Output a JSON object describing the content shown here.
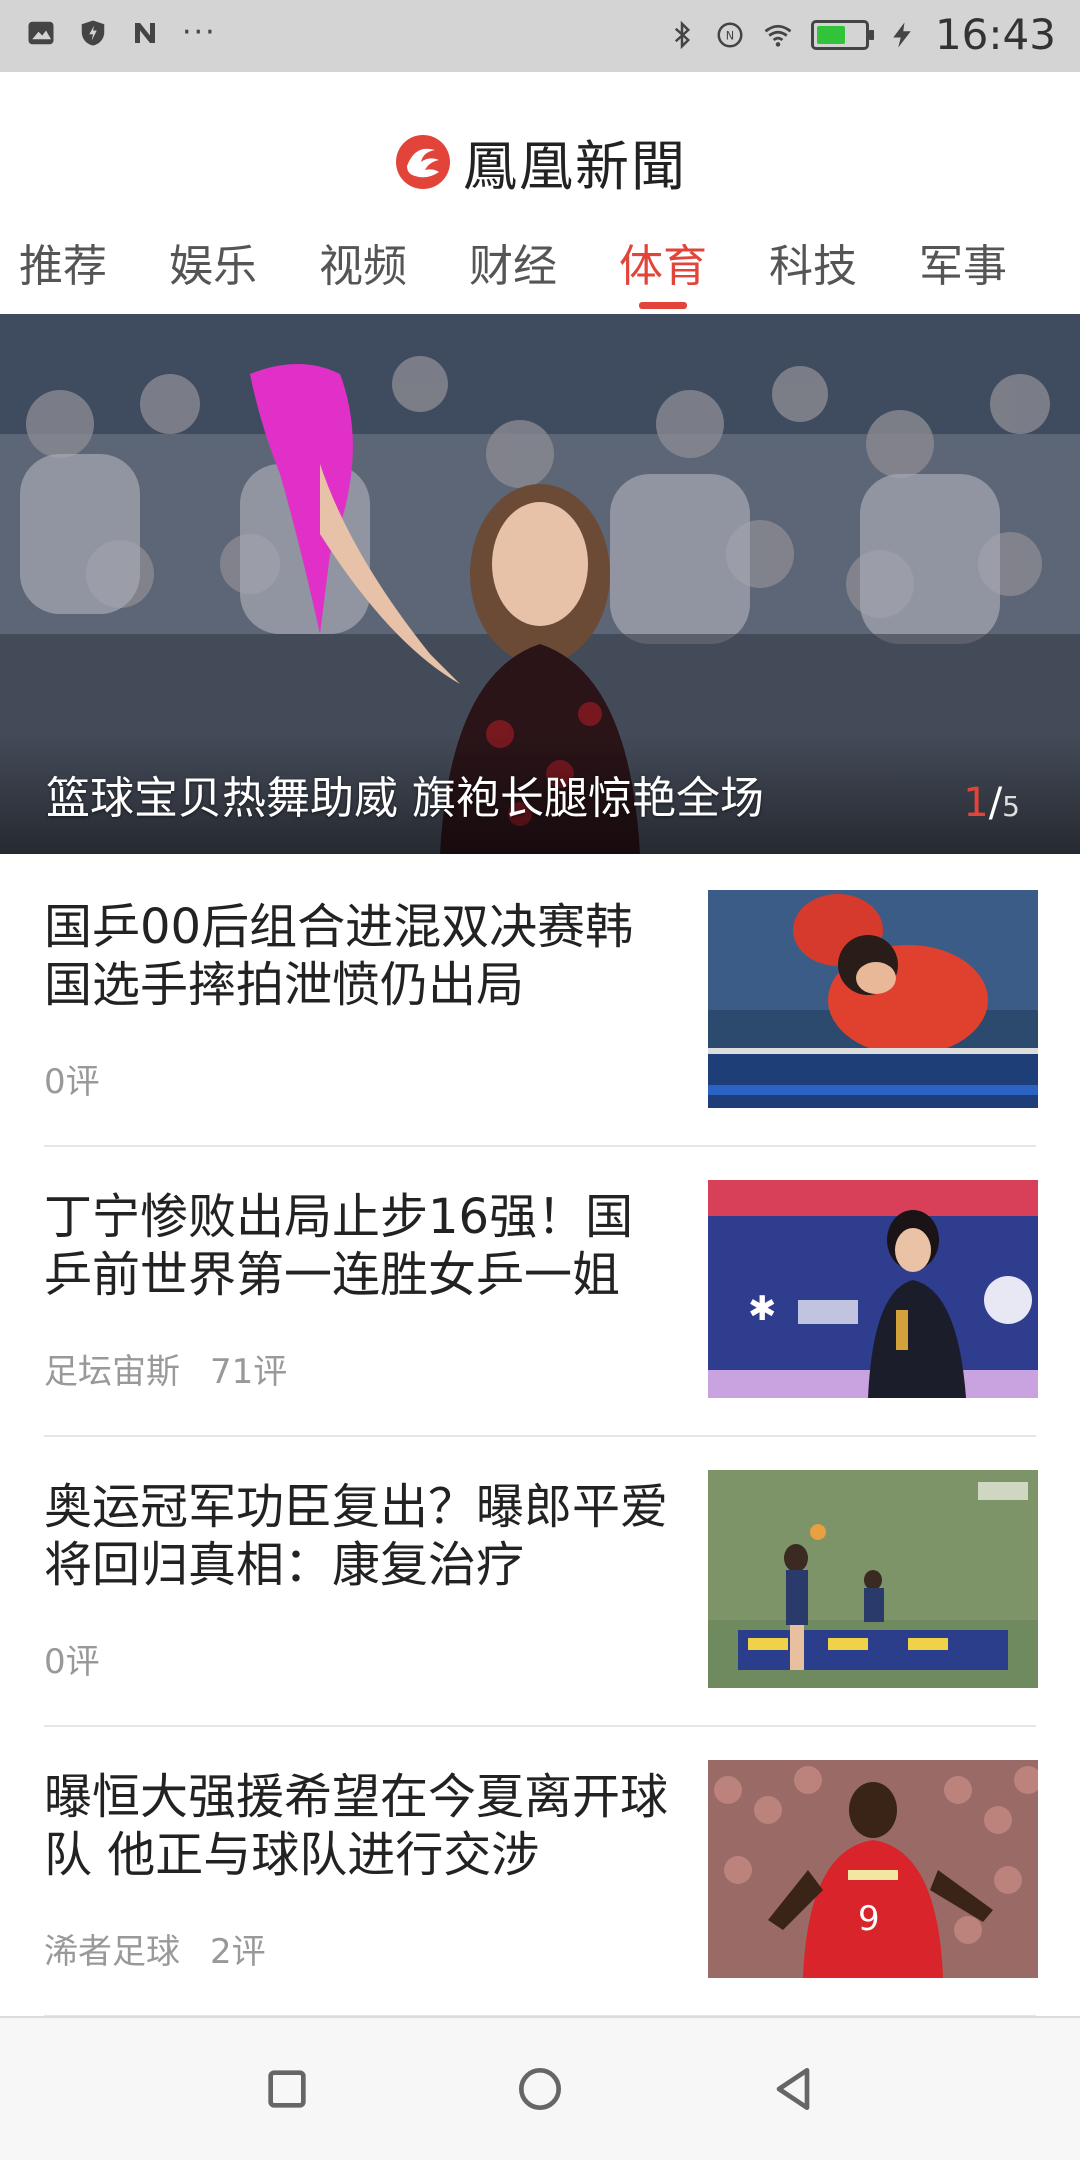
{
  "status_bar": {
    "time": "16:43",
    "left_icons": [
      "gallery-icon",
      "shield-icon",
      "n-app-icon"
    ],
    "overflow_dots": "···",
    "right_icons": [
      "bluetooth-icon",
      "nfc-icon",
      "wifi-icon",
      "battery-icon",
      "charging-icon"
    ],
    "battery_level": 0.6,
    "battery_color": "#31c43a"
  },
  "header": {
    "logo_text": "鳳凰新聞",
    "brand_color": "#e2443a"
  },
  "tabs": [
    {
      "label": "推荐"
    },
    {
      "label": "娱乐"
    },
    {
      "label": "视频"
    },
    {
      "label": "财经"
    },
    {
      "label": "体育",
      "active": true
    },
    {
      "label": "科技"
    },
    {
      "label": "军事"
    }
  ],
  "hero": {
    "caption": "篮球宝贝热舞助威 旗袍长腿惊艳全场",
    "counter_current": "1",
    "counter_sep": "/",
    "counter_total": "5"
  },
  "news": [
    {
      "title": "国乒00后组合进混双决赛韩国选手摔拍泄愤仍出局",
      "source": "",
      "comments": "0评",
      "thumb": "table-tennis-photo"
    },
    {
      "title": "丁宁惨败出局止步16强！国乒前世界第一连胜女乒一姐",
      "source": "足坛宙斯",
      "comments": "71评",
      "thumb": "table-tennis-player-photo"
    },
    {
      "title": "奥运冠军功臣复出？曝郎平爱将回归真相：康复治疗",
      "source": "",
      "comments": "0评",
      "thumb": "volleyball-photo"
    },
    {
      "title": "曝恒大强援希望在今夏离开球队 他正与球队进行交涉",
      "source": "浠者足球",
      "comments": "2评",
      "thumb": "football-player-photo"
    }
  ],
  "navbar": {
    "buttons": [
      "recents-square-icon",
      "home-circle-icon",
      "back-triangle-icon"
    ]
  }
}
